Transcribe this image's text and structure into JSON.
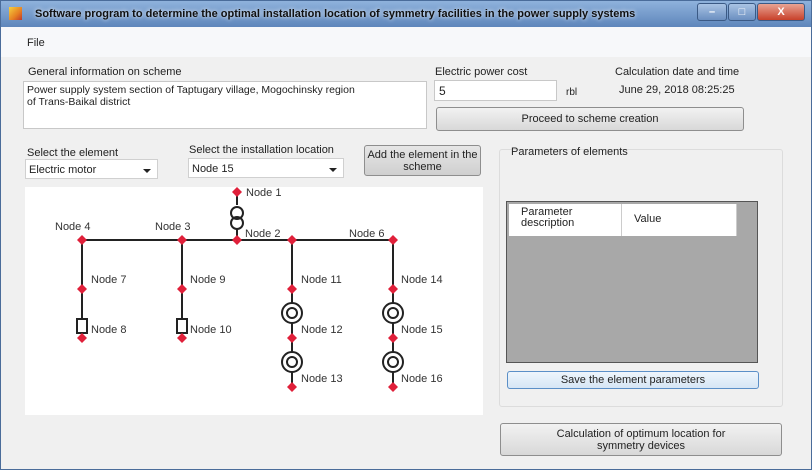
{
  "window": {
    "title": "Software program to determine the optimal installation location of symmetry facilities in the power supply systems",
    "minimize": "–",
    "maximize": "□",
    "close": "X"
  },
  "menu": {
    "file": "File"
  },
  "general": {
    "label": "General information on scheme",
    "text": "Power supply system section of Taptugary village, Mogochinsky region\nof Trans-Baikal district"
  },
  "cost": {
    "label": "Electric power cost",
    "value": "5",
    "unit": "rbl"
  },
  "calc_date": {
    "label": "Calculation date and time",
    "value": "June 29, 2018 08:25:25"
  },
  "proceed_button": "Proceed to scheme creation",
  "select_element": {
    "label": "Select the element",
    "value": "Electric motor"
  },
  "select_location": {
    "label": "Select the installation location",
    "value": "Node 15"
  },
  "add_button": "Add the element in the scheme",
  "diagram": {
    "nodes": {
      "n1": "Node 1",
      "n2": "Node 2",
      "n3": "Node 3",
      "n4": "Node 4",
      "n6": "Node 6",
      "n7": "Node 7",
      "n8": "Node 8",
      "n9": "Node 9",
      "n10": "Node 10",
      "n11": "Node 11",
      "n12": "Node 12",
      "n13": "Node 13",
      "n14": "Node 14",
      "n15": "Node 15",
      "n16": "Node 16"
    },
    "node_color": "#e0203a"
  },
  "params": {
    "label": "Parameters of elements",
    "col_desc": "Parameter description",
    "col_value": "Value",
    "save_button": "Save the element parameters"
  },
  "calc_button": "Calculation of optimum location for symmetry devices"
}
